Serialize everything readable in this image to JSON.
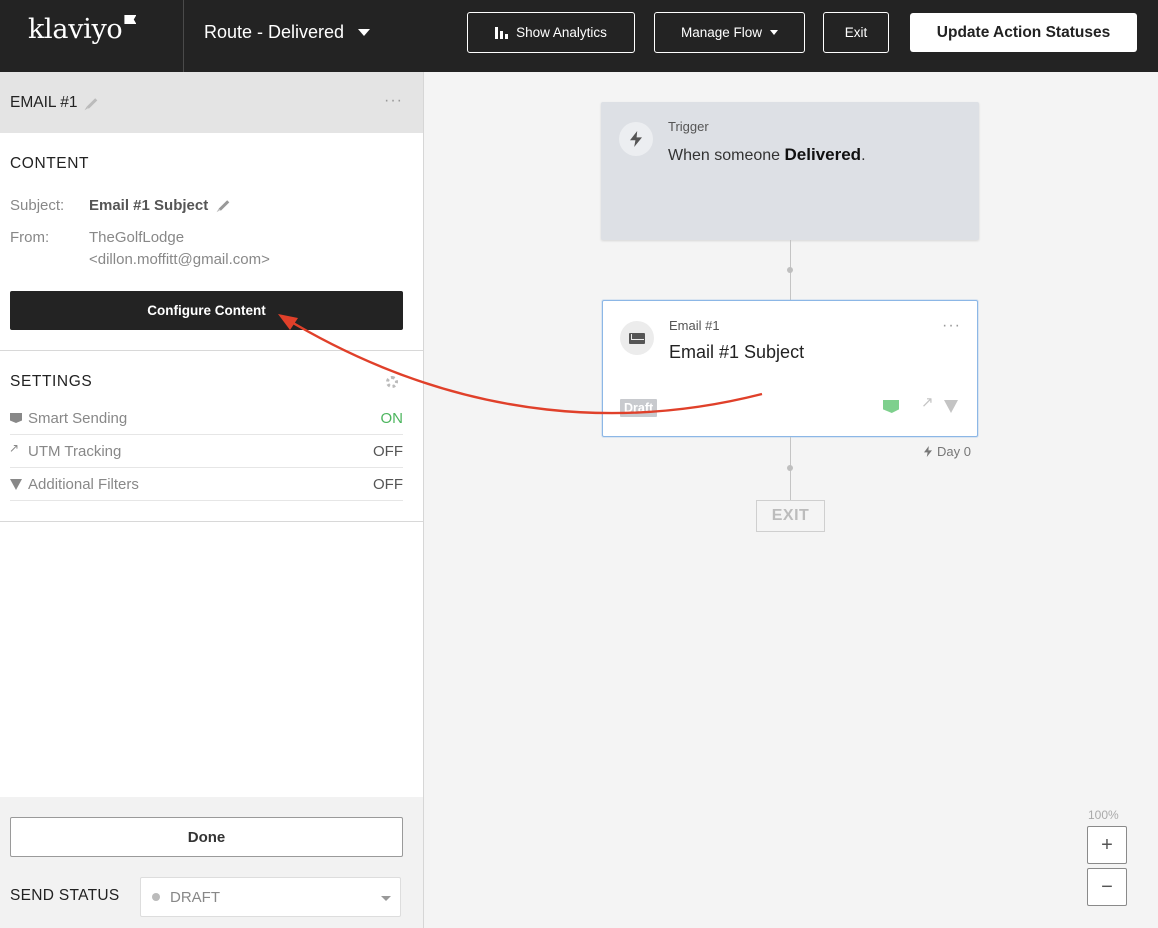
{
  "header": {
    "logo": "klaviyo",
    "flow_name": "Route - Delivered",
    "show_analytics": "Show Analytics",
    "manage_flow": "Manage Flow",
    "exit": "Exit",
    "update_statuses": "Update Action Statuses"
  },
  "panel": {
    "title": "EMAIL #1",
    "content": {
      "heading": "CONTENT",
      "subject_key": "Subject:",
      "subject_value": "Email #1 Subject",
      "from_key": "From:",
      "from_name": "TheGolfLodge",
      "from_email": "<dillon.moffitt@gmail.com>",
      "configure_button": "Configure Content"
    },
    "settings": {
      "heading": "SETTINGS",
      "rows": [
        {
          "label": "Smart Sending",
          "value": "ON",
          "icon": "smart-sending-icon"
        },
        {
          "label": "UTM Tracking",
          "value": "OFF",
          "icon": "utm-tracking-icon"
        },
        {
          "label": "Additional Filters",
          "value": "OFF",
          "icon": "filter-icon"
        }
      ]
    },
    "done_button": "Done",
    "send_status_label": "SEND STATUS",
    "send_status_value": "DRAFT"
  },
  "canvas": {
    "trigger": {
      "kicker": "Trigger",
      "text_prefix": "When someone ",
      "event": "Delivered",
      "text_suffix": "."
    },
    "email_card": {
      "kicker": "Email #1",
      "subject": "Email #1 Subject",
      "badge": "Draft",
      "delay": "Day 0"
    },
    "exit_label": "EXIT",
    "zoom_level": "100%",
    "zoom_in": "+",
    "zoom_out": "−"
  },
  "colors": {
    "topbar": "#232323",
    "on_status": "#4cb55e",
    "annotation_arrow": "#e0402a",
    "selected_card_border": "#8cb7e6"
  }
}
